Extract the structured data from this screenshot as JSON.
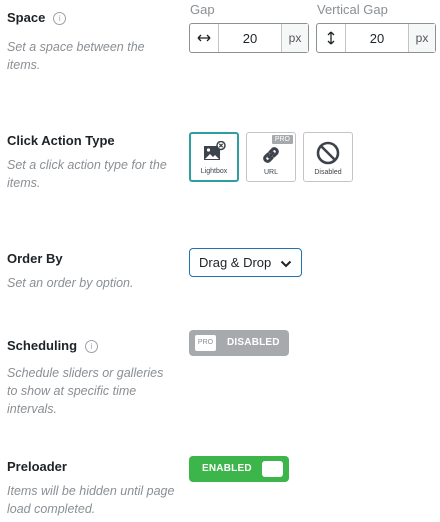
{
  "space": {
    "label": "Space",
    "info": "i",
    "description": "Set a space between the items.",
    "gap": {
      "caption": "Gap",
      "icon": "horizontal-arrows-icon",
      "value": "20",
      "unit": "px"
    },
    "vertical_gap": {
      "caption": "Vertical Gap",
      "icon": "vertical-arrows-icon",
      "value": "20",
      "unit": "px"
    }
  },
  "click_action": {
    "label": "Click Action Type",
    "description": "Set a click action type for the items.",
    "options": [
      {
        "label": "Lightbox",
        "icon": "lightbox-icon",
        "selected": true
      },
      {
        "label": "URL",
        "icon": "link-icon",
        "badge": "PRO"
      },
      {
        "label": "Disabled",
        "icon": "disabled-icon"
      }
    ]
  },
  "order_by": {
    "label": "Order By",
    "description": "Set an order by option.",
    "selected": "Drag & Drop"
  },
  "scheduling": {
    "label": "Scheduling",
    "info": "i",
    "description": "Schedule sliders or galleries to show at specific time intervals.",
    "badge": "PRO",
    "state": "DISABLED"
  },
  "preloader": {
    "label": "Preloader",
    "description": "Items will be hidden until page load completed.",
    "state": "ENABLED"
  },
  "colors": {
    "accent_teal": "#2e9e9e",
    "toggle_on": "#3cb54a",
    "toggle_off": "#a7aaad",
    "select_border": "#2271b1"
  }
}
